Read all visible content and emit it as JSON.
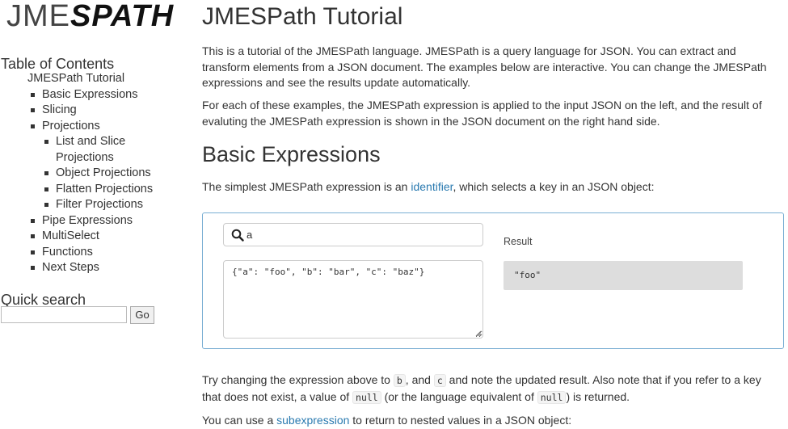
{
  "logo": {
    "thin": "JME",
    "bold": "SPATH"
  },
  "toc": {
    "heading": "Table of Contents",
    "root": "JMESPath Tutorial",
    "items": [
      {
        "label": "Basic Expressions"
      },
      {
        "label": "Slicing"
      },
      {
        "label": "Projections",
        "children": [
          {
            "label_line1": "List and Slice",
            "label_line2": "Projections"
          },
          {
            "label": "Object Projections"
          },
          {
            "label": "Flatten Projections"
          },
          {
            "label": "Filter Projections"
          }
        ]
      },
      {
        "label": "Pipe Expressions"
      },
      {
        "label": "MultiSelect"
      },
      {
        "label": "Functions"
      },
      {
        "label": "Next Steps"
      }
    ]
  },
  "quick_search": {
    "heading": "Quick search",
    "value": "",
    "go_label": "Go"
  },
  "main": {
    "title": "JMESPath Tutorial",
    "intro_1": "This is a tutorial of the JMESPath language. JMESPath is a query language for JSON. You can extract and transform elements from a JSON document. The examples below are interactive. You can change the JMESPath expressions and see the results update automatically.",
    "intro_2": "For each of these examples, the JMESPath expression is applied to the input JSON on the left, and the result of evaluting the JMESPath expression is shown in the JSON document on the right hand side.",
    "section_heading": "Basic Expressions",
    "basic": {
      "before_link": "The simplest JMESPath expression is an ",
      "link": "identifier",
      "after_link": ", which selects a key in an JSON object:"
    },
    "example": {
      "expression": "a",
      "json_input": "{\"a\": \"foo\", \"b\": \"bar\", \"c\": \"baz\"}",
      "result_label": "Result",
      "result": "\"foo\""
    },
    "try": {
      "t1": "Try changing the expression above to ",
      "c1": "b",
      "t2": ", and ",
      "c2": "c",
      "t3": " and note the updated result. Also note that if you refer to a key that does not exist, a value of ",
      "c3": "null",
      "t4": " (or the language equivalent of ",
      "c4": "null",
      "t5": ") is returned."
    },
    "sub": {
      "before_link": "You can use a ",
      "link": "subexpression",
      "after_link": " to return to nested values in a JSON object:"
    }
  },
  "colors": {
    "link": "#2a7ab0",
    "example_border": "#79aed3",
    "result_bg": "#dddddd"
  },
  "icons": {
    "search": "search-icon"
  }
}
